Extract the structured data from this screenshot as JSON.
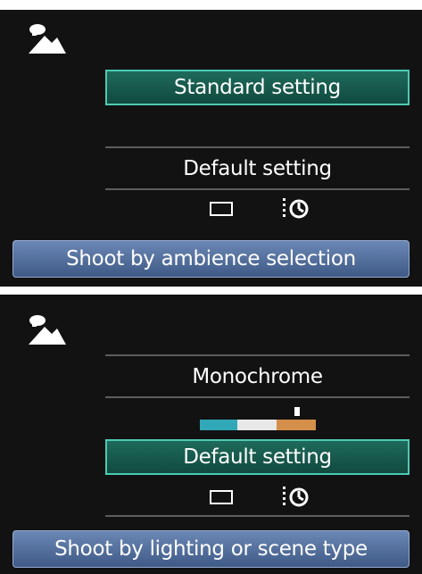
{
  "screen_top": {
    "scene_icon": "landscape-scene-icon",
    "selected_option": "Standard setting",
    "default_option": "Default setting",
    "icons": [
      "single-shot-icon",
      "self-timer-icon"
    ],
    "footer_label": "Shoot by ambience selection"
  },
  "screen_bottom": {
    "scene_icon": "landscape-scene-icon",
    "option_label": "Monochrome",
    "monochrome_tone_bar": {
      "segments": [
        "#31a8b8",
        "#e8e8e8",
        "#d4904a"
      ],
      "selected_segment": 3
    },
    "selected_option": "Default setting",
    "icons": [
      "single-shot-icon",
      "self-timer-icon"
    ],
    "footer_label": "Shoot by lighting or scene type"
  },
  "colors": {
    "panel_background": "#121212",
    "highlight_fill": "#166152",
    "highlight_border": "#4ccab4",
    "footer_fill": "#56709f"
  }
}
